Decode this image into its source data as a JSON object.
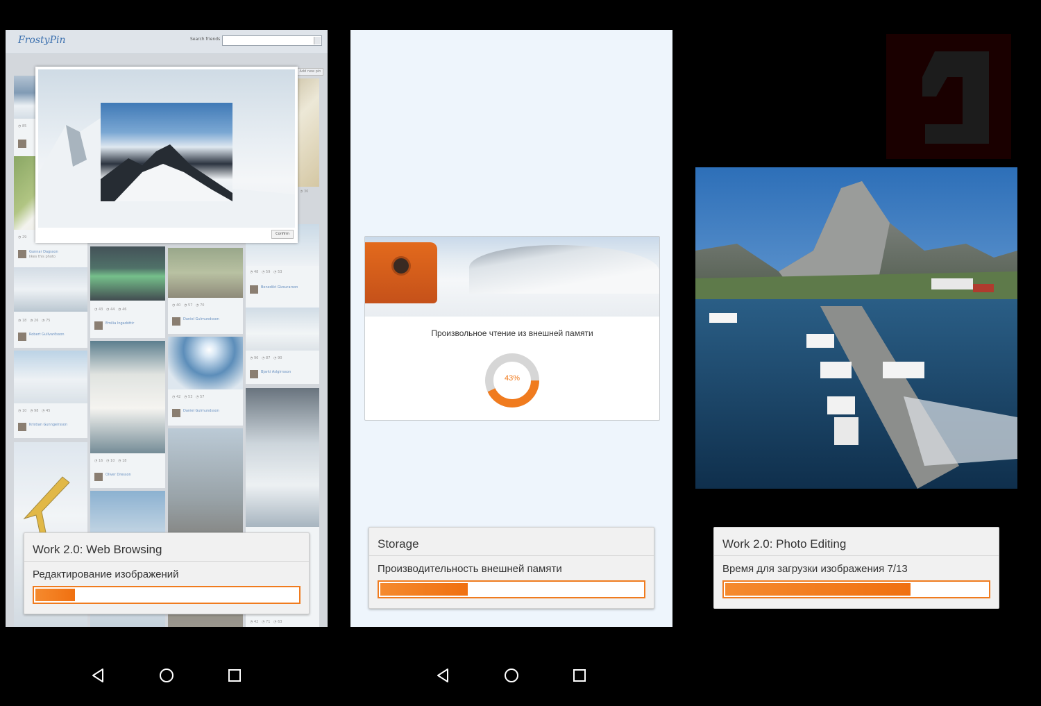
{
  "panels": [
    {
      "app": {
        "logo": "FrostyPin",
        "search_label": "Search friends",
        "add_pin": "Add new pin",
        "modal_confirm": "Confirm",
        "users": [
          "Gunnar Dagsson",
          "Robert Gullvarðsson",
          "Emilia Ingadóttir",
          "Daniel Gulmundsson",
          "Benedikt Gizsurarson",
          "Bjarki Aslgirrsson",
          "Kristian Gunngeirsson",
          "Oliver Dresson"
        ],
        "save_text": "likes this photo"
      },
      "overlay": {
        "title": "Work 2.0: Web Browsing",
        "subtitle": "Редактирование изображений",
        "progress": 0.16
      }
    },
    {
      "text": "Произвольное чтение из внешней памяти",
      "donut_label": "43%",
      "donut_value": 0.43,
      "overlay": {
        "title": "Storage",
        "subtitle": "Производительность внешней памяти",
        "progress": 0.34
      }
    },
    {
      "overlay": {
        "title": "Work 2.0: Photo Editing",
        "subtitle": "Время для загрузки изображения 7/13",
        "progress": 0.71
      }
    }
  ],
  "colors": {
    "accent": "#f07b1e",
    "background": "#000000"
  },
  "nav_icons": [
    "back-icon",
    "home-icon",
    "recents-icon"
  ]
}
